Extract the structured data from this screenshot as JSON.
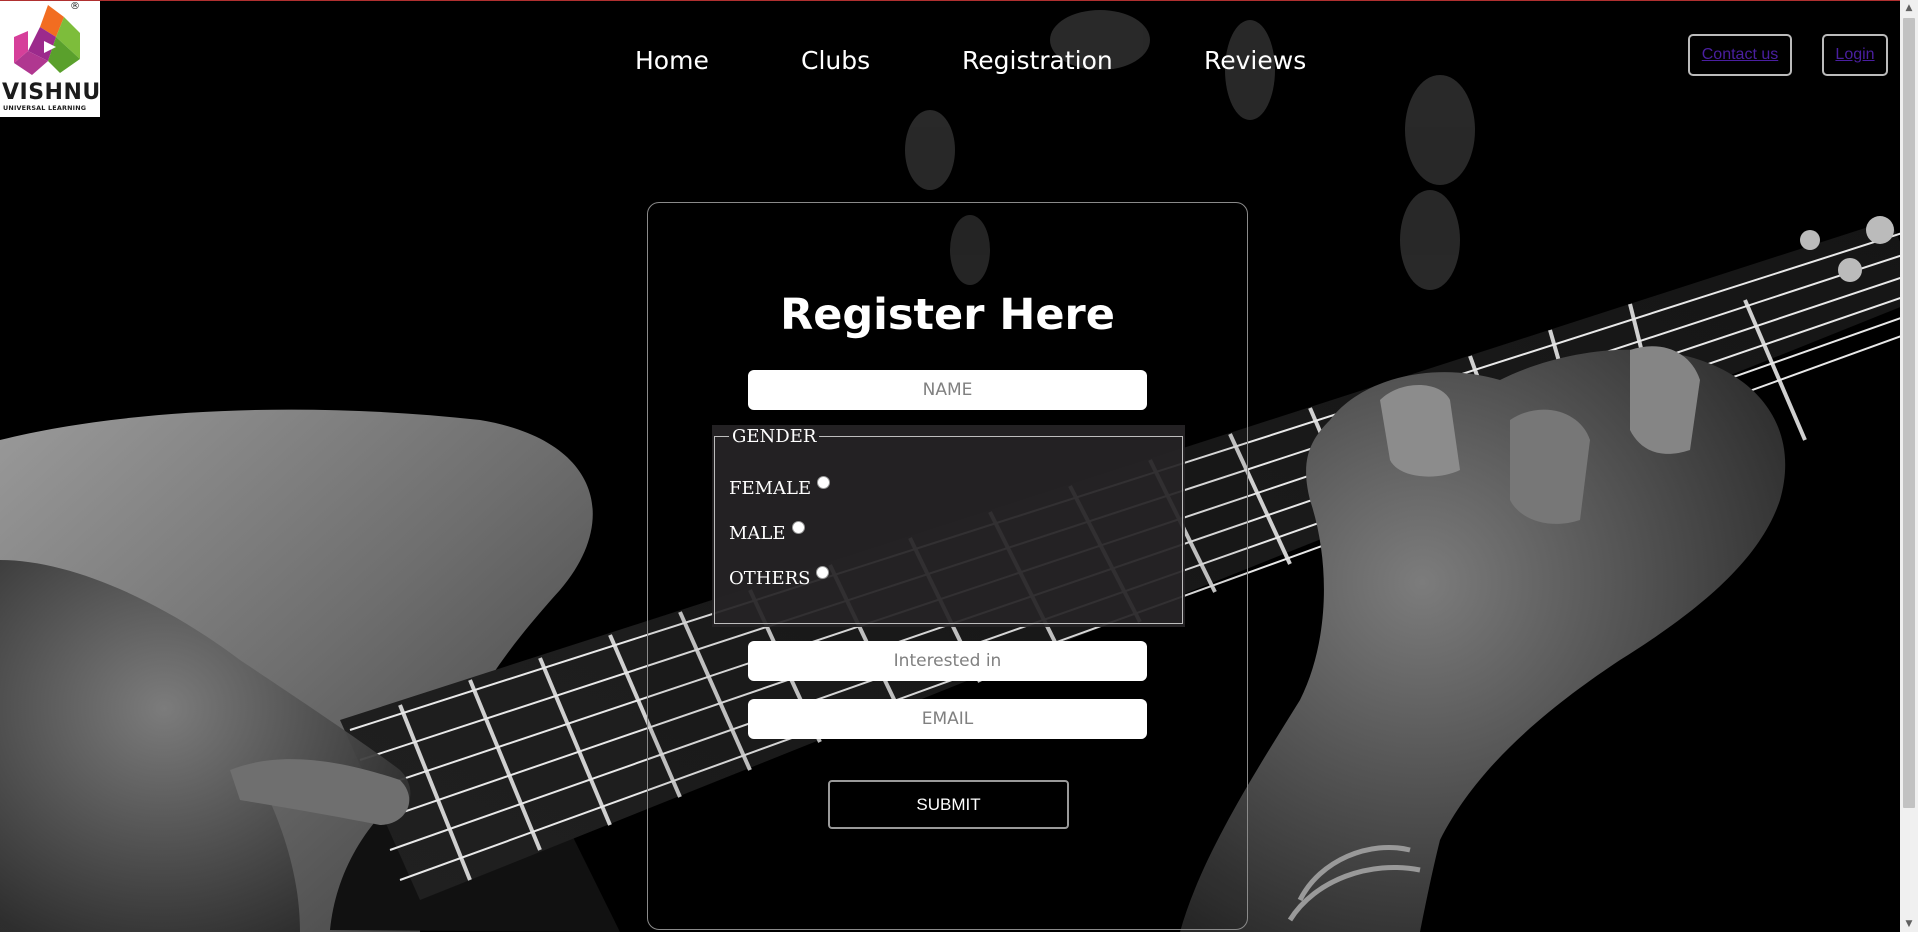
{
  "brand": {
    "name": "VISHNU",
    "tagline": "UNIVERSAL LEARNING",
    "registered_mark": "®"
  },
  "nav": {
    "items": [
      {
        "label": "Home"
      },
      {
        "label": "Clubs"
      },
      {
        "label": "Registration"
      },
      {
        "label": "Reviews"
      }
    ],
    "contact_label": "Contact us",
    "login_label": "Login"
  },
  "form": {
    "title": "Register Here",
    "name_placeholder": "NAME",
    "gender_legend": "GENDER",
    "gender_options": [
      {
        "label": "FEMALE",
        "selected": false
      },
      {
        "label": "MALE",
        "selected": false
      },
      {
        "label": "OTHERS",
        "selected": false
      }
    ],
    "interest_placeholder": "Interested in",
    "email_placeholder": "EMAIL",
    "submit_label": "SUBMIT"
  },
  "colors": {
    "link": "#4a1fa0",
    "background": "#000000",
    "text": "#ffffff"
  }
}
